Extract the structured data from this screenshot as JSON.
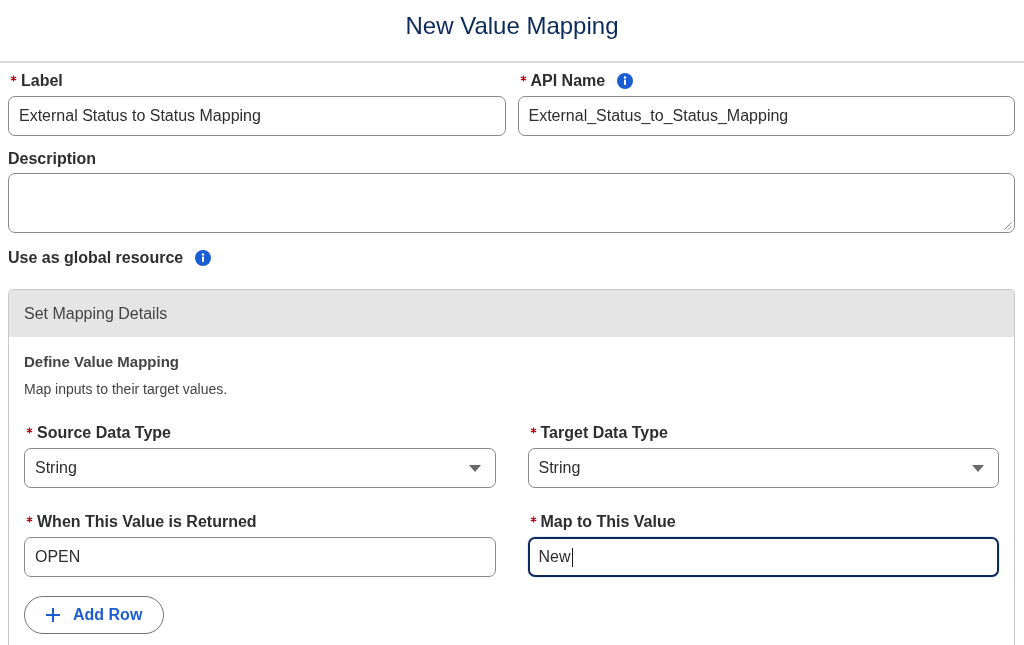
{
  "header": {
    "title": "New Value Mapping"
  },
  "fields": [
    {
      "kind": "text",
      "label": "Label",
      "required": true,
      "info": false,
      "value": "External Status to Status Mapping"
    },
    {
      "kind": "text",
      "label": "API Name",
      "required": true,
      "info": true,
      "value": "External_Status_to_Status_Mapping"
    },
    {
      "kind": "textarea",
      "label": "Description",
      "required": false,
      "info": false
    }
  ],
  "global_resource": {
    "label": "Use as global resource",
    "info": true
  },
  "mapping_panel": {
    "title": "Set Mapping Details",
    "section_title": "Define Value Mapping",
    "section_description": "Map inputs to their target values.",
    "fields": [
      {
        "kind": "select",
        "label": "Source Data Type",
        "required": true,
        "value": "String",
        "focused": false
      },
      {
        "kind": "select",
        "label": "Target Data Type",
        "required": true,
        "value": "String",
        "focused": false
      },
      {
        "kind": "text",
        "label": "When This Value is Returned",
        "required": true,
        "value": "OPEN",
        "focused": false
      },
      {
        "kind": "text",
        "label": "Map to This Value",
        "required": true,
        "value": "New",
        "focused": true
      }
    ],
    "add_button": {
      "label": "Add Row"
    }
  }
}
